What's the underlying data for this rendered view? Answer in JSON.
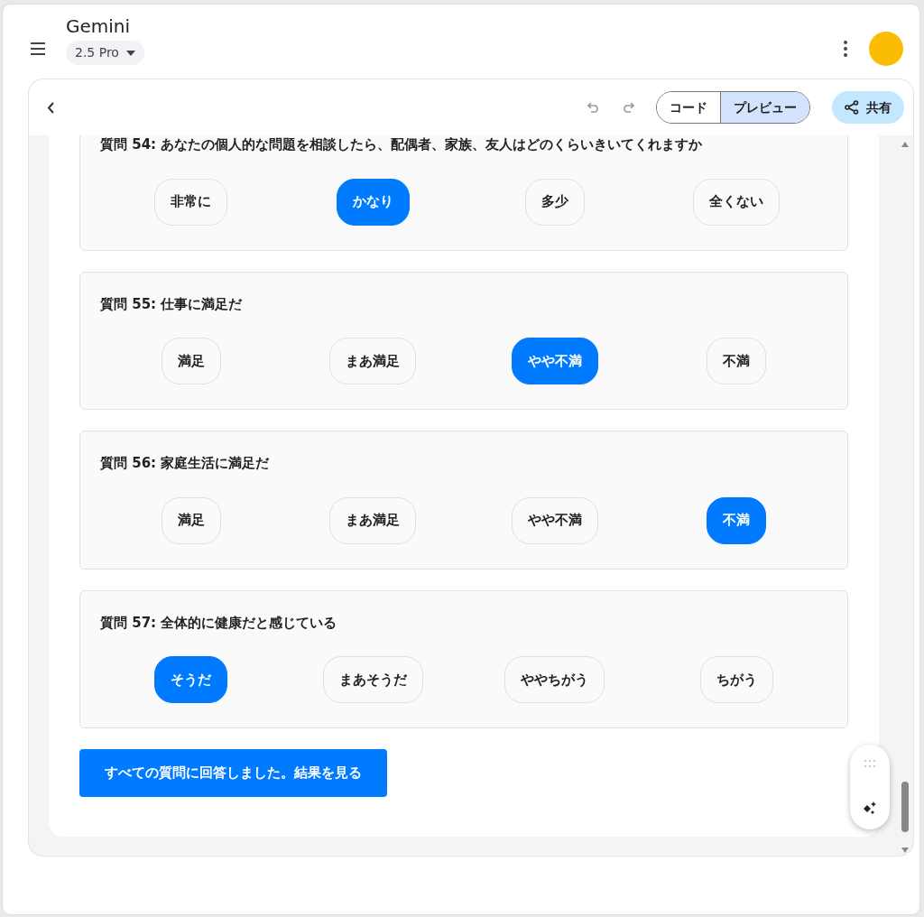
{
  "header": {
    "title": "Gemini",
    "model": "2.5 Pro"
  },
  "toolbar": {
    "views": [
      {
        "label": "コード",
        "selected": false
      },
      {
        "label": "プレビュー",
        "selected": true
      }
    ],
    "share": "共有"
  },
  "questions": [
    {
      "label": "質問 54: あなたの個人的な問題を相談したら、配偶者、家族、友人はどのくらいきいてくれますか",
      "options": [
        {
          "label": "非常に",
          "selected": false
        },
        {
          "label": "かなり",
          "selected": true
        },
        {
          "label": "多少",
          "selected": false
        },
        {
          "label": "全くない",
          "selected": false
        }
      ]
    },
    {
      "label": "質問 55: 仕事に満足だ",
      "options": [
        {
          "label": "満足",
          "selected": false
        },
        {
          "label": "まあ満足",
          "selected": false
        },
        {
          "label": "やや不満",
          "selected": true
        },
        {
          "label": "不満",
          "selected": false
        }
      ]
    },
    {
      "label": "質問 56: 家庭生活に満足だ",
      "options": [
        {
          "label": "満足",
          "selected": false
        },
        {
          "label": "まあ満足",
          "selected": false
        },
        {
          "label": "やや不満",
          "selected": false
        },
        {
          "label": "不満",
          "selected": true
        }
      ]
    },
    {
      "label": "質問 57: 全体的に健康だと感じている",
      "options": [
        {
          "label": "そうだ",
          "selected": true
        },
        {
          "label": "まあそうだ",
          "selected": false
        },
        {
          "label": "ややちがう",
          "selected": false
        },
        {
          "label": "ちがう",
          "selected": false
        }
      ]
    }
  ],
  "submit": "すべての質問に回答しました。結果を見る"
}
